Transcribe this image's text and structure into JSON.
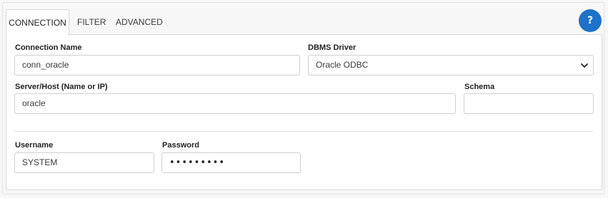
{
  "tabs": {
    "connection": "CONNECTION",
    "filter": "FILTER",
    "advanced": "ADVANCED"
  },
  "help": {
    "label": "?",
    "icon": "question-icon",
    "color": "#1e72c7"
  },
  "form": {
    "connection_name": {
      "label": "Connection Name",
      "value": "conn_oracle"
    },
    "dbms_driver": {
      "label": "DBMS Driver",
      "value": "Oracle ODBC",
      "icon": "chevron-down-icon"
    },
    "server_host": {
      "label": "Server/Host (Name or IP)",
      "value": "oracle"
    },
    "schema": {
      "label": "Schema",
      "value": ""
    },
    "username": {
      "label": "Username",
      "value": "SYSTEM"
    },
    "password": {
      "label": "Password",
      "value": "•••••••••"
    }
  }
}
